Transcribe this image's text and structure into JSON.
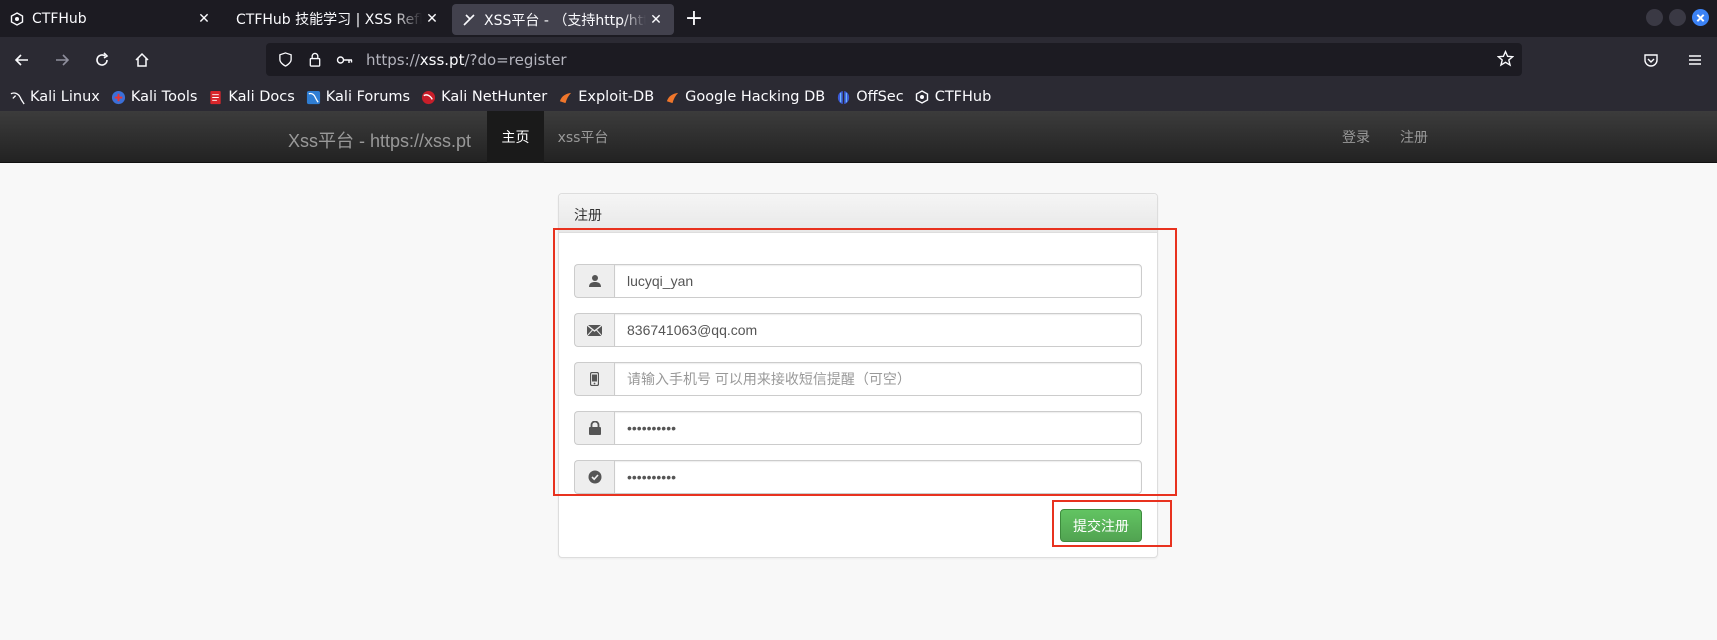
{
  "browser": {
    "tabs": [
      {
        "title": "CTFHub",
        "active": false
      },
      {
        "title": "CTFHub 技能学习 | XSS Reflected",
        "active": false
      },
      {
        "title": "XSS平台 - （支持http/https）",
        "active": true
      }
    ],
    "url_prefix": "https://",
    "url_domain": "xss.pt",
    "url_path": "/?do=register",
    "bookmarks": [
      {
        "label": "Kali Linux",
        "icon": "kali-dragon-icon"
      },
      {
        "label": "Kali Tools",
        "icon": "kali-tools-icon"
      },
      {
        "label": "Kali Docs",
        "icon": "kali-docs-icon"
      },
      {
        "label": "Kali Forums",
        "icon": "kali-forums-icon"
      },
      {
        "label": "Kali NetHunter",
        "icon": "nethunter-icon"
      },
      {
        "label": "Exploit-DB",
        "icon": "exploit-db-icon"
      },
      {
        "label": "Google Hacking DB",
        "icon": "ghdb-icon"
      },
      {
        "label": "OffSec",
        "icon": "offsec-icon"
      },
      {
        "label": "CTFHub",
        "icon": "ctfhub-icon"
      }
    ]
  },
  "site": {
    "brand": "Xss平台 - https://xss.pt",
    "nav": [
      {
        "label": "主页",
        "active": true
      },
      {
        "label": "xss平台",
        "active": false
      }
    ],
    "nav_right": [
      {
        "label": "登录"
      },
      {
        "label": "注册"
      }
    ]
  },
  "form": {
    "heading": "注册",
    "username": {
      "value": "lucyqi_yan",
      "icon": "user-icon"
    },
    "email": {
      "value": "836741063@qq.com",
      "icon": "envelope-icon"
    },
    "phone": {
      "value": "",
      "placeholder": "请输入手机号 可以用来接收短信提醒（可空）",
      "icon": "phone-icon"
    },
    "password": {
      "value": "1234567890",
      "icon": "lock-icon"
    },
    "confirm": {
      "value": "1234567890",
      "icon": "check-circle-icon"
    },
    "submit_label": "提交注册"
  },
  "colors": {
    "highlight": "#e8321f",
    "submit": "#5bb75b",
    "tab_bar": "#1c1b22",
    "toolbar": "#2b2a33"
  }
}
